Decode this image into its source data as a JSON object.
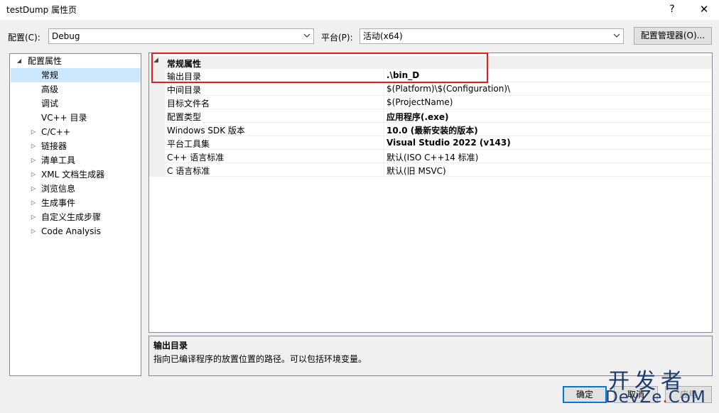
{
  "window": {
    "title": "testDump 属性页",
    "help": "?",
    "close": "✕"
  },
  "config": {
    "config_label": "配置(C):",
    "config_value": "Debug",
    "platform_label": "平台(P):",
    "platform_value": "活动(x64)",
    "manager_button": "配置管理器(O)..."
  },
  "tree": {
    "items": [
      {
        "label": "配置属性",
        "expander": "◢"
      },
      {
        "label": "常规"
      },
      {
        "label": "高级"
      },
      {
        "label": "调试"
      },
      {
        "label": "VC++ 目录"
      },
      {
        "label": "C/C++",
        "expander": "▷"
      },
      {
        "label": "链接器",
        "expander": "▷"
      },
      {
        "label": "清单工具",
        "expander": "▷"
      },
      {
        "label": "XML 文档生成器",
        "expander": "▷"
      },
      {
        "label": "浏览信息",
        "expander": "▷"
      },
      {
        "label": "生成事件",
        "expander": "▷"
      },
      {
        "label": "自定义生成步骤",
        "expander": "▷"
      },
      {
        "label": "Code Analysis",
        "expander": "▷"
      }
    ]
  },
  "grid": {
    "category": "常规属性",
    "category_expander": "◢",
    "rows": [
      {
        "name": "输出目录",
        "value": ".\\bin_D"
      },
      {
        "name": "中间目录",
        "value": "$(Platform)\\$(Configuration)\\"
      },
      {
        "name": "目标文件名",
        "value": "$(ProjectName)"
      },
      {
        "name": "配置类型",
        "value": "应用程序(.exe)"
      },
      {
        "name": "Windows SDK 版本",
        "value": "10.0 (最新安装的版本)"
      },
      {
        "name": "平台工具集",
        "value": "Visual Studio 2022 (v143)"
      },
      {
        "name": "C++ 语言标准",
        "value": "默认(ISO C++14 标准)"
      },
      {
        "name": "C 语言标准",
        "value": "默认(旧 MSVC)"
      }
    ]
  },
  "description": {
    "title": "输出目录",
    "text": "指向已编译程序的放置位置的路径。可以包括环境变量。"
  },
  "buttons": {
    "ok": "确定",
    "cancel": "取消",
    "apply": "应用"
  },
  "watermark": {
    "line1": "开发者",
    "line2_a": "DevZe",
    "line2_dot": ".",
    "line2_b": "CoM"
  },
  "colors": {
    "selection": "#cce8ff",
    "highlight_box": "#e0201c",
    "primary_border": "#0078d7"
  }
}
